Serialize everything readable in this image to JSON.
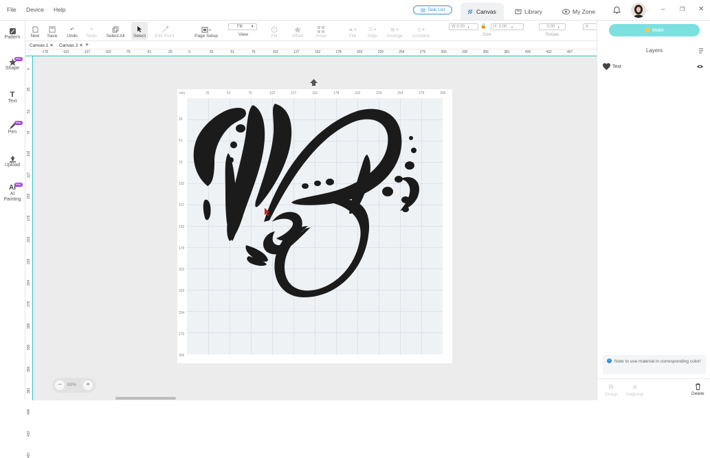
{
  "menu": [
    "File",
    "Device",
    "Help"
  ],
  "task_list": "Task List",
  "nav": {
    "canvas": "Canvas",
    "library": "Library",
    "myzone": "My Zone"
  },
  "toolbar": {
    "new": "New",
    "save": "Save",
    "undo": "Undo",
    "redo": "Redo",
    "select_all": "Select All",
    "select": "Select",
    "edit_point": "Edit Point",
    "page_setup": "Page Setup",
    "view_value": "Fill",
    "view": "View",
    "fill": "Fill",
    "offset": "Offset",
    "array": "Array",
    "flip": "Flip",
    "align": "Align",
    "arrange": "Arrange",
    "combine": "Combine",
    "w_label": "W",
    "w_value": "0.00",
    "h_label": "H",
    "h_value": "0.00",
    "size": "Size",
    "rotate_value": "0.00",
    "rotate": "Rotate",
    "x_label": "X"
  },
  "left_tools": {
    "pattern": "Pattern",
    "shape": "Shape",
    "text": "Text",
    "pen": "Pen",
    "upload": "Upload",
    "ai_line1": "AI",
    "ai_line2": "Painting",
    "pro": "PRO"
  },
  "canvas_tabs": [
    "Canvas 1",
    "Canvas 2"
  ],
  "ruler_top": [
    "-178",
    "-152",
    "-127",
    "-102",
    "-76",
    "-51",
    "-25",
    "0",
    "25",
    "51",
    "76",
    "102",
    "127",
    "152",
    "178",
    "203",
    "229",
    "254",
    "279",
    "305",
    "330",
    "356",
    "381",
    "406",
    "432",
    "457"
  ],
  "ruler_left": [
    "0",
    "25",
    "51",
    "76",
    "102",
    "127",
    "152",
    "178",
    "203",
    "229",
    "254",
    "279",
    "305",
    "330",
    "356",
    "381",
    "406",
    "432",
    "457"
  ],
  "paper_unit": "mm",
  "paper_ruler_top": [
    "25",
    "51",
    "76",
    "102",
    "127",
    "152",
    "178",
    "203",
    "229",
    "254",
    "279",
    "305"
  ],
  "paper_ruler_left": [
    "25",
    "51",
    "76",
    "102",
    "127",
    "152",
    "178",
    "203",
    "229",
    "254",
    "279",
    "305"
  ],
  "zoom": "80%",
  "right": {
    "make": "Make",
    "layers": "Layers",
    "layer_name": "Text",
    "note": "Note to use material in corresponding color!",
    "group": "Group",
    "ungroup": "Ungroup",
    "delete": "Delete"
  },
  "colors": {
    "accent": "#26c3c6",
    "make": "#7de0e0",
    "pro": "#9b39e6",
    "link": "#2f8fd8"
  }
}
